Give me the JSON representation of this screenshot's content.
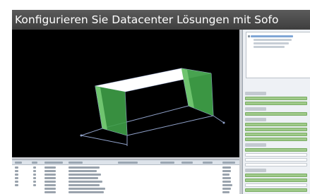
{
  "title_bar": {
    "text": "Konfigurieren Sie Datacenter Lösungen mit Sofo"
  },
  "viewport": {
    "background": "#000000",
    "rack_top_color": "#ffffff",
    "rack_side_color": "#3e9e47",
    "wireframe_color": "#8fa0c8"
  },
  "right_panel": {
    "tree_item_count": 4,
    "property_rows": 22
  },
  "table": {
    "column_count": 9,
    "row_count": 8
  }
}
